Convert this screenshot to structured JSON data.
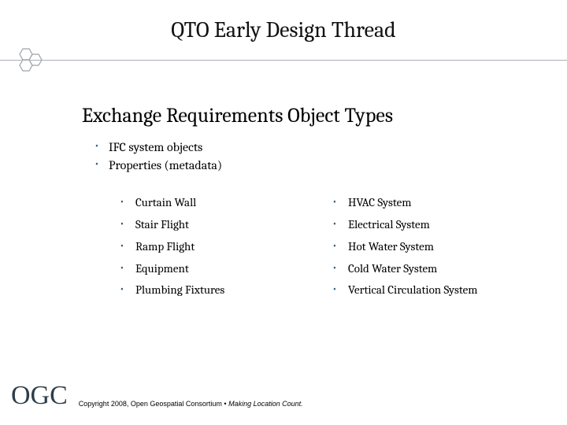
{
  "title": "QTO Early Design Thread",
  "subtitle": "Exchange Requirements Object Types",
  "intro_items": [
    "IFC system objects",
    "Properties (metadata)"
  ],
  "left_items": [
    "Curtain Wall",
    "Stair Flight",
    "Ramp Flight",
    "Equipment",
    "Plumbing Fixtures"
  ],
  "right_items": [
    "HVAC System",
    "Electrical System",
    "Hot Water System",
    "Cold Water System",
    "Vertical Circulation System"
  ],
  "footer": {
    "logo": "OGC",
    "copy_prefix": "Copyright  2008, Open Geospatial Consortium • ",
    "copy_em": "Making Location Count."
  }
}
